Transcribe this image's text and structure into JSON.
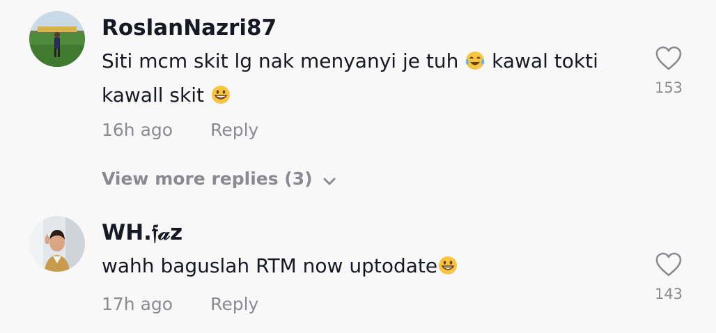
{
  "comments": [
    {
      "username": "RoslanNazri87",
      "text_part1": "Siti mcm skit lg nak menyanyi je tuh ",
      "emoji1": "tears-of-joy-emoji",
      "text_part2": " kawal tokti kawall skit ",
      "emoji2": "grinning-emoji",
      "time": "16h ago",
      "reply_label": "Reply",
      "likes": "153"
    },
    {
      "username": "WH.𝔣𝒶z",
      "text_part1": "wahh baguslah RTM now uptodate",
      "emoji1": "grinning-emoji",
      "time": "17h ago",
      "reply_label": "Reply",
      "likes": "143"
    }
  ],
  "view_more_replies": "View more replies (3)",
  "colors": {
    "text_primary": "#161823",
    "text_secondary": "#8a8b91",
    "background": "#f8f8f8"
  }
}
